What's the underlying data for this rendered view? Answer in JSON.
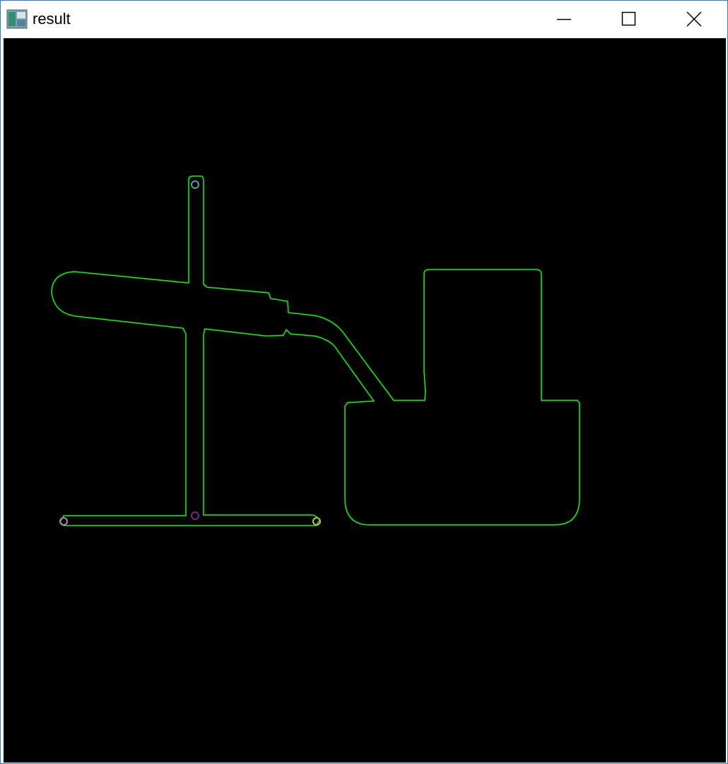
{
  "window": {
    "title": "result",
    "icon": "opencv-window-icon",
    "controls": {
      "minimize_icon": "minimize-icon",
      "maximize_icon": "maximize-icon",
      "close_icon": "close-icon"
    }
  },
  "canvas": {
    "background": "#000000",
    "contour_color": "#00ff00",
    "markers": [
      {
        "name": "marker-top",
        "color": "#5aa0a0"
      },
      {
        "name": "marker-center",
        "color": "#7a2a8a"
      },
      {
        "name": "marker-left",
        "color": "#b080c0"
      },
      {
        "name": "marker-right",
        "color": "#c8c030"
      }
    ]
  }
}
